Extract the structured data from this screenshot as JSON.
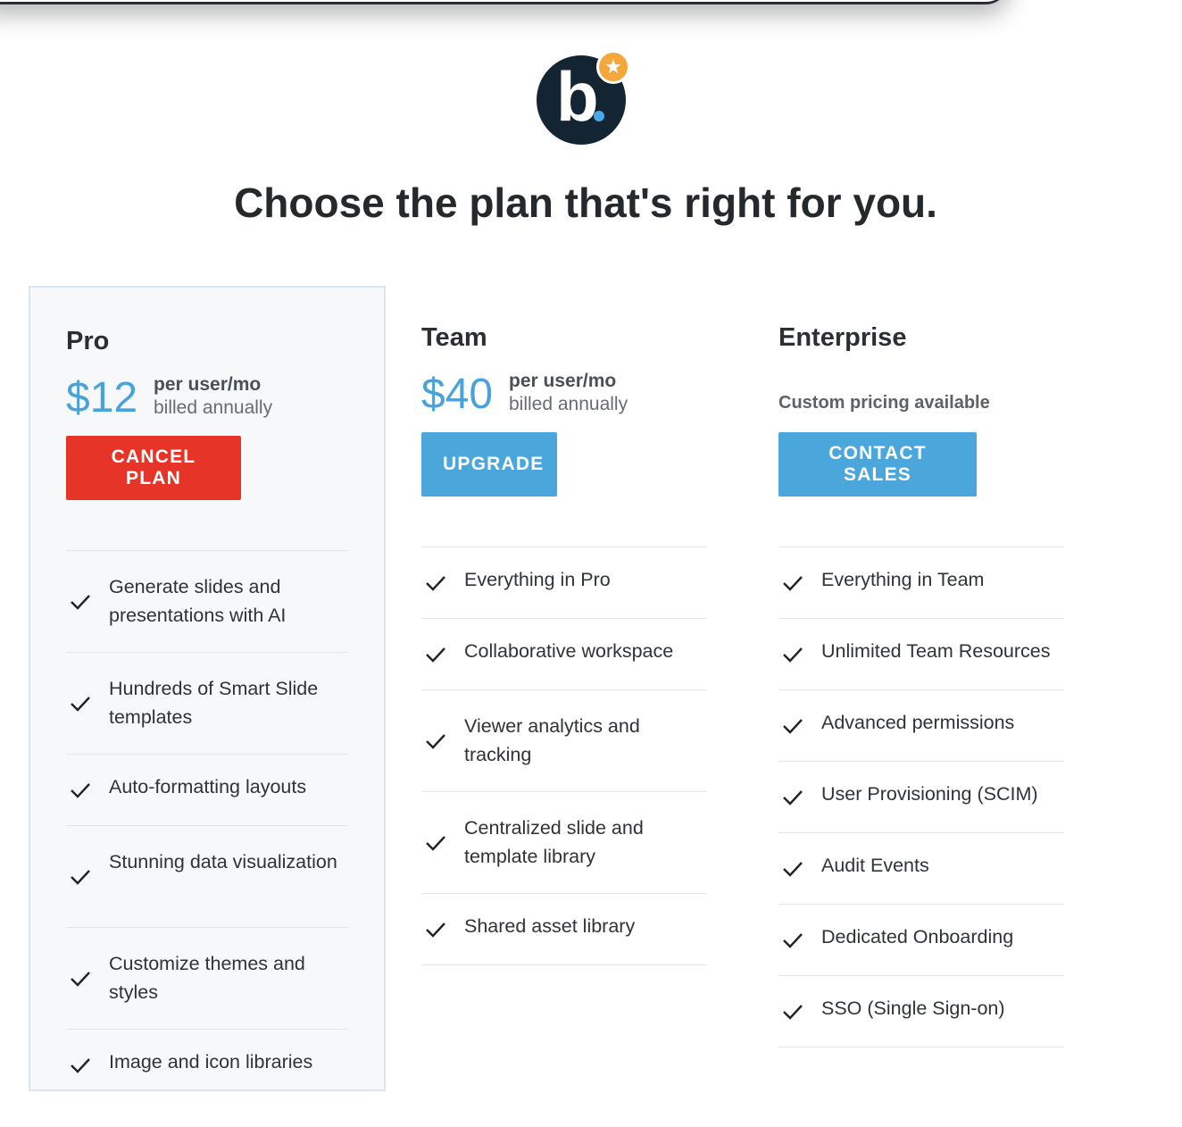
{
  "brand": {
    "logo_letter": "b",
    "badge_icon": "star-icon",
    "accent": "#4aa2da",
    "danger": "#e63428",
    "dark": "#132533"
  },
  "headline": "Choose the plan that's right for you.",
  "plans": [
    {
      "name": "Pro",
      "price": "$12",
      "per": "per user/mo",
      "billed": "billed annually",
      "button": "CANCEL PLAN",
      "current": true,
      "features": [
        "Generate slides and presentations with AI",
        "Hundreds of Smart Slide templates",
        "Auto-formatting layouts",
        "Stunning data visualization",
        "Customize themes and styles",
        "Image and icon libraries"
      ]
    },
    {
      "name": "Team",
      "price": "$40",
      "per": "per user/mo",
      "billed": "billed annually",
      "button": "UPGRADE",
      "features": [
        "Everything in Pro",
        "Collaborative workspace",
        "Viewer analytics and tracking",
        "Centralized slide and template library",
        "Shared asset library"
      ]
    },
    {
      "name": "Enterprise",
      "custom": "Custom pricing available",
      "button": "CONTACT SALES",
      "features": [
        "Everything in Team",
        "Unlimited Team Resources",
        "Advanced permissions",
        "User Provisioning (SCIM)",
        "Audit Events",
        "Dedicated Onboarding",
        "SSO (Single Sign-on)"
      ]
    }
  ]
}
